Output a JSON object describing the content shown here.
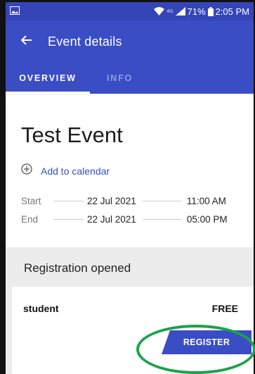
{
  "status_bar": {
    "battery": "71%",
    "time": "2:05 PM",
    "network_label": "4G"
  },
  "app_bar": {
    "title": "Event details",
    "back_icon": "arrow-left-icon"
  },
  "tabs": [
    {
      "label": "OVERVIEW",
      "active": true
    },
    {
      "label": "INFO",
      "active": false
    }
  ],
  "event": {
    "title": "Test Event",
    "add_to_calendar": "Add to calendar",
    "start": {
      "label": "Start",
      "date": "22 Jul 2021",
      "time": "11:00 AM"
    },
    "end": {
      "label": "End",
      "date": "22 Jul 2021",
      "time": "05:00 PM"
    }
  },
  "registration": {
    "status": "Registration opened",
    "ticket": {
      "name": "student",
      "price": "FREE",
      "button": "REGISTER"
    }
  },
  "colors": {
    "primary": "#3a4dc4",
    "highlight": "#1ba34a"
  }
}
